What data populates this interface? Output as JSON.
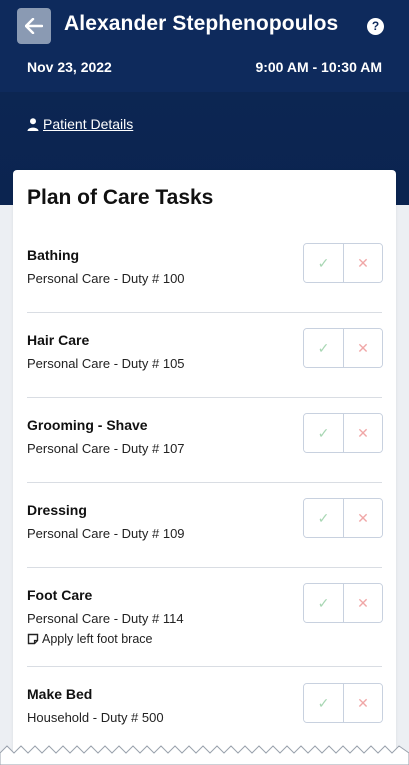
{
  "header": {
    "title": "Alexander Stephenopoulos",
    "date": "Nov 23, 2022",
    "time_range": "9:00 AM - 10:30 AM",
    "help_label": "?",
    "patient_link": "Patient Details",
    "colors": {
      "header_bg": "#0e2a5c",
      "back_button_bg": "#8a9ab3"
    }
  },
  "card": {
    "title": "Plan of Care Tasks",
    "check_glyph": "✓",
    "cross_glyph": "✕",
    "tasks": [
      {
        "name": "Bathing",
        "detail": "Personal Care - Duty # 100"
      },
      {
        "name": "Hair Care",
        "detail": "Personal Care - Duty # 105"
      },
      {
        "name": "Grooming - Shave",
        "detail": "Personal Care - Duty # 107"
      },
      {
        "name": "Dressing",
        "detail": "Personal Care - Duty # 109"
      },
      {
        "name": "Foot Care",
        "detail": "Personal Care - Duty # 114",
        "note": "Apply left foot brace"
      },
      {
        "name": "Make Bed",
        "detail": "Household - Duty # 500"
      }
    ]
  },
  "colors": {
    "check": "#a9d7b4",
    "cross": "#f0a7a7",
    "border": "#c8d1df"
  }
}
